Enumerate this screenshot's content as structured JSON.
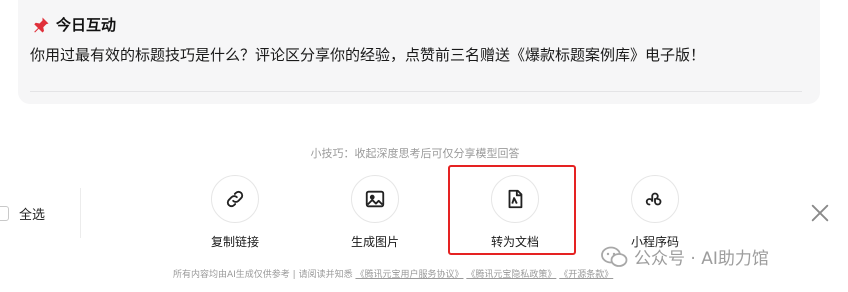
{
  "interaction_card": {
    "title": "今日互动",
    "body": "你用过最有效的标题技巧是什么？评论区分享你的经验，点赞前三名赠送《爆款标题案例库》电子版！"
  },
  "tip": "小技巧：收起深度思考后可仅分享模型回答",
  "select_all_label": "全选",
  "actions": [
    {
      "label": "复制链接",
      "icon": "link-icon"
    },
    {
      "label": "生成图片",
      "icon": "image-icon"
    },
    {
      "label": "转为文档",
      "icon": "document-icon",
      "highlighted": true
    },
    {
      "label": "小程序码",
      "icon": "miniprogram-icon"
    }
  ],
  "footer": {
    "prefix": "所有内容均由AI生成仅供参考 | 请阅读并知悉",
    "link1": "《腾讯元宝用户服务协议》",
    "link2": "《腾讯元宝隐私政策》",
    "link3": "《开源条款》"
  },
  "watermark": "公众号 · AI助力馆",
  "colors": {
    "highlight": "#e52222",
    "card_bg": "#f6f6f7"
  }
}
